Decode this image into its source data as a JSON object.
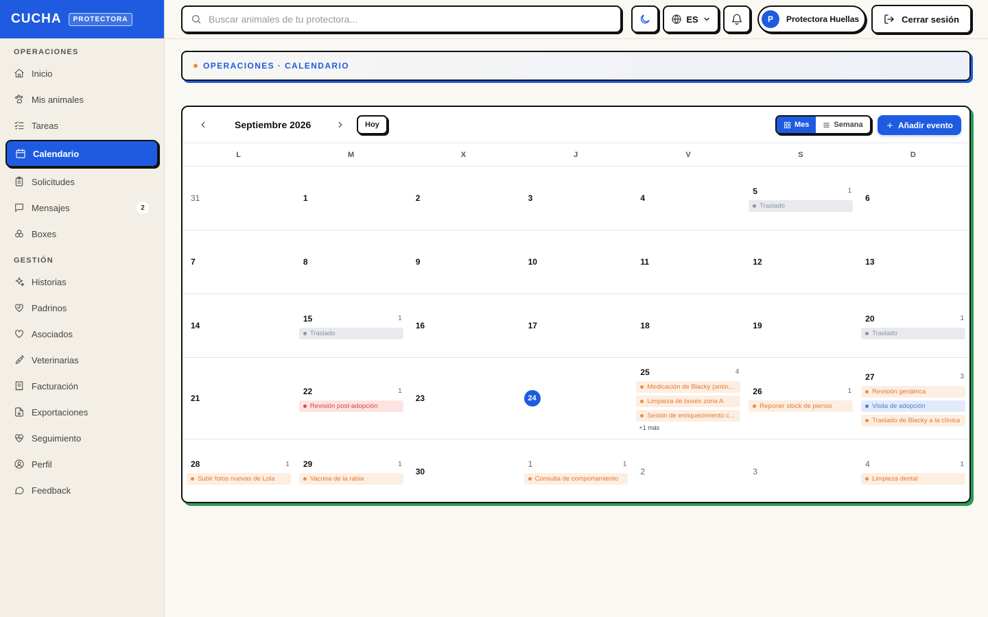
{
  "brand": {
    "name": "CUCHA",
    "badge": "PROTECTORA"
  },
  "sidebar": {
    "sections": [
      {
        "title": "OPERACIONES",
        "items": [
          {
            "label": "Inicio",
            "icon": "home-icon"
          },
          {
            "label": "Mis animales",
            "icon": "paw-icon"
          },
          {
            "label": "Tareas",
            "icon": "list-check-icon"
          },
          {
            "label": "Calendario",
            "icon": "calendar-icon",
            "active": true
          },
          {
            "label": "Solicitudes",
            "icon": "clipboard-icon"
          },
          {
            "label": "Mensajes",
            "icon": "message-icon",
            "badge": "2"
          },
          {
            "label": "Boxes",
            "icon": "boxes-icon"
          }
        ]
      },
      {
        "title": "GESTIÓN",
        "items": [
          {
            "label": "Historias",
            "icon": "sparkles-icon"
          },
          {
            "label": "Padrinos",
            "icon": "heart-handshake-icon"
          },
          {
            "label": "Asociados",
            "icon": "heart-icon"
          },
          {
            "label": "Veterinarias",
            "icon": "syringe-icon"
          },
          {
            "label": "Facturación",
            "icon": "receipt-icon"
          },
          {
            "label": "Exportaciones",
            "icon": "file-export-icon"
          },
          {
            "label": "Seguimiento",
            "icon": "heart-pulse-icon"
          },
          {
            "label": "Perfil",
            "icon": "user-circle-icon"
          },
          {
            "label": "Feedback",
            "icon": "chat-icon"
          }
        ]
      }
    ]
  },
  "topbar": {
    "search_placeholder": "Buscar animales de tu protectora...",
    "language": "ES",
    "user_initial": "P",
    "user_name": "Protectora Huellas",
    "logout_label": "Cerrar sesión"
  },
  "breadcrumb": "OPERACIONES · CALENDARIO",
  "calendar": {
    "month_label": "Septiembre 2026",
    "today_label": "Hoy",
    "view_month": "Mes",
    "view_week": "Semana",
    "add_event_label": "Añadir evento",
    "weekdays": [
      "L",
      "M",
      "X",
      "J",
      "V",
      "S",
      "D"
    ],
    "weeks": [
      {
        "days": [
          {
            "num": "31",
            "muted": true
          },
          {
            "num": "1"
          },
          {
            "num": "2"
          },
          {
            "num": "3"
          },
          {
            "num": "4"
          },
          {
            "num": "5",
            "count": "1",
            "events": [
              {
                "label": "Traslado",
                "color": "gray"
              }
            ]
          },
          {
            "num": "6"
          }
        ]
      },
      {
        "days": [
          {
            "num": "7"
          },
          {
            "num": "8"
          },
          {
            "num": "9"
          },
          {
            "num": "10"
          },
          {
            "num": "11"
          },
          {
            "num": "12"
          },
          {
            "num": "13"
          }
        ]
      },
      {
        "days": [
          {
            "num": "14"
          },
          {
            "num": "15",
            "count": "1",
            "events": [
              {
                "label": "Traslado",
                "color": "gray"
              }
            ]
          },
          {
            "num": "16"
          },
          {
            "num": "17"
          },
          {
            "num": "18"
          },
          {
            "num": "19"
          },
          {
            "num": "20",
            "count": "1",
            "events": [
              {
                "label": "Traslado",
                "color": "gray"
              }
            ]
          }
        ]
      },
      {
        "days": [
          {
            "num": "21"
          },
          {
            "num": "22",
            "count": "1",
            "events": [
              {
                "label": "Revisión post-adopción",
                "color": "red"
              }
            ]
          },
          {
            "num": "23"
          },
          {
            "num": "24",
            "today": true
          },
          {
            "num": "25",
            "count": "4",
            "events": [
              {
                "label": "Medicación de Blacky (antin...",
                "color": "orange"
              },
              {
                "label": "Limpieza de boxes zona A",
                "color": "orange"
              },
              {
                "label": "Sesión de enriquecimiento c...",
                "color": "orange"
              }
            ],
            "more": "+1 más"
          },
          {
            "num": "26",
            "count": "1",
            "events": [
              {
                "label": "Reponer stock de pienso",
                "color": "orange"
              }
            ]
          },
          {
            "num": "27",
            "count": "3",
            "events": [
              {
                "label": "Revisión geriátrica",
                "color": "orange"
              },
              {
                "label": "Visita de adopción",
                "color": "blue"
              },
              {
                "label": "Traslado de Blacky a la clínica",
                "color": "orange"
              }
            ]
          }
        ]
      },
      {
        "days": [
          {
            "num": "28",
            "count": "1",
            "events": [
              {
                "label": "Subir fotos nuevas de Lola",
                "color": "orange"
              }
            ]
          },
          {
            "num": "29",
            "count": "1",
            "events": [
              {
                "label": "Vacuna de la rabia",
                "color": "orange"
              }
            ]
          },
          {
            "num": "30"
          },
          {
            "num": "1",
            "muted": true,
            "count": "1",
            "events": [
              {
                "label": "Consulta de comportamiento",
                "color": "orange"
              }
            ]
          },
          {
            "num": "2",
            "muted": true
          },
          {
            "num": "3",
            "muted": true
          },
          {
            "num": "4",
            "muted": true,
            "count": "1",
            "events": [
              {
                "label": "Limpieza dental",
                "color": "orange"
              }
            ]
          }
        ]
      }
    ]
  }
}
